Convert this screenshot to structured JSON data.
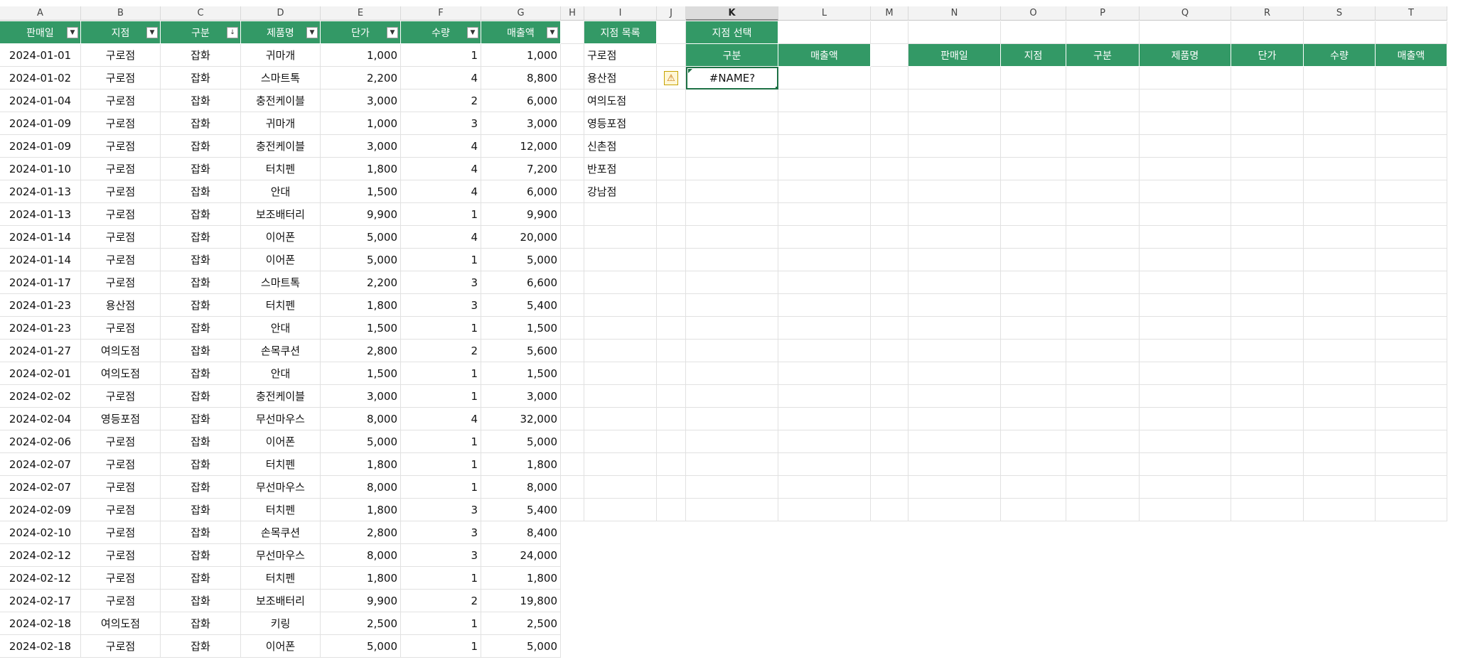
{
  "columns": [
    "A",
    "B",
    "C",
    "D",
    "E",
    "F",
    "G",
    "H",
    "I",
    "J",
    "K",
    "L",
    "M",
    "N",
    "O",
    "P",
    "Q",
    "R",
    "S",
    "T"
  ],
  "active_column": "K",
  "main_table": {
    "headers": [
      "판매일",
      "지점",
      "구분",
      "제품명",
      "단가",
      "수량",
      "매출액"
    ],
    "rows": [
      [
        "2024-01-01",
        "구로점",
        "잡화",
        "귀마개",
        "1,000",
        "1",
        "1,000"
      ],
      [
        "2024-01-02",
        "구로점",
        "잡화",
        "스마트톡",
        "2,200",
        "4",
        "8,800"
      ],
      [
        "2024-01-04",
        "구로점",
        "잡화",
        "충전케이블",
        "3,000",
        "2",
        "6,000"
      ],
      [
        "2024-01-09",
        "구로점",
        "잡화",
        "귀마개",
        "1,000",
        "3",
        "3,000"
      ],
      [
        "2024-01-09",
        "구로점",
        "잡화",
        "충전케이블",
        "3,000",
        "4",
        "12,000"
      ],
      [
        "2024-01-10",
        "구로점",
        "잡화",
        "터치펜",
        "1,800",
        "4",
        "7,200"
      ],
      [
        "2024-01-13",
        "구로점",
        "잡화",
        "안대",
        "1,500",
        "4",
        "6,000"
      ],
      [
        "2024-01-13",
        "구로점",
        "잡화",
        "보조배터리",
        "9,900",
        "1",
        "9,900"
      ],
      [
        "2024-01-14",
        "구로점",
        "잡화",
        "이어폰",
        "5,000",
        "4",
        "20,000"
      ],
      [
        "2024-01-14",
        "구로점",
        "잡화",
        "이어폰",
        "5,000",
        "1",
        "5,000"
      ],
      [
        "2024-01-17",
        "구로점",
        "잡화",
        "스마트톡",
        "2,200",
        "3",
        "6,600"
      ],
      [
        "2024-01-23",
        "용산점",
        "잡화",
        "터치펜",
        "1,800",
        "3",
        "5,400"
      ],
      [
        "2024-01-23",
        "구로점",
        "잡화",
        "안대",
        "1,500",
        "1",
        "1,500"
      ],
      [
        "2024-01-27",
        "여의도점",
        "잡화",
        "손목쿠션",
        "2,800",
        "2",
        "5,600"
      ],
      [
        "2024-02-01",
        "여의도점",
        "잡화",
        "안대",
        "1,500",
        "1",
        "1,500"
      ],
      [
        "2024-02-02",
        "구로점",
        "잡화",
        "충전케이블",
        "3,000",
        "1",
        "3,000"
      ],
      [
        "2024-02-04",
        "영등포점",
        "잡화",
        "무선마우스",
        "8,000",
        "4",
        "32,000"
      ],
      [
        "2024-02-06",
        "구로점",
        "잡화",
        "이어폰",
        "5,000",
        "1",
        "5,000"
      ],
      [
        "2024-02-07",
        "구로점",
        "잡화",
        "터치펜",
        "1,800",
        "1",
        "1,800"
      ],
      [
        "2024-02-07",
        "구로점",
        "잡화",
        "무선마우스",
        "8,000",
        "1",
        "8,000"
      ],
      [
        "2024-02-09",
        "구로점",
        "잡화",
        "터치펜",
        "1,800",
        "3",
        "5,400"
      ],
      [
        "2024-02-10",
        "구로점",
        "잡화",
        "손목쿠션",
        "2,800",
        "3",
        "8,400"
      ],
      [
        "2024-02-12",
        "구로점",
        "잡화",
        "무선마우스",
        "8,000",
        "3",
        "24,000"
      ],
      [
        "2024-02-12",
        "구로점",
        "잡화",
        "터치펜",
        "1,800",
        "1",
        "1,800"
      ],
      [
        "2024-02-17",
        "구로점",
        "잡화",
        "보조배터리",
        "9,900",
        "2",
        "19,800"
      ],
      [
        "2024-02-18",
        "여의도점",
        "잡화",
        "키링",
        "2,500",
        "1",
        "2,500"
      ],
      [
        "2024-02-18",
        "구로점",
        "잡화",
        "이어폰",
        "5,000",
        "1",
        "5,000"
      ]
    ]
  },
  "branch_list": {
    "header": "지점 목록",
    "items": [
      "구로점",
      "용산점",
      "여의도점",
      "영등포점",
      "신촌점",
      "반포점",
      "강남점"
    ]
  },
  "branch_select": {
    "header": "지점 선택"
  },
  "summary": {
    "headers": [
      "구분",
      "매출액"
    ],
    "result": "#NAME?"
  },
  "result_table": {
    "headers": [
      "판매일",
      "지점",
      "구분",
      "제품명",
      "단가",
      "수량",
      "매출액"
    ]
  },
  "icons": {
    "filter": "filter-dropdown-icon",
    "sorted_filter": "sort-filter-icon",
    "warning": "warning-icon"
  },
  "colors": {
    "header_green": "#339966",
    "active_border": "#1e7145"
  }
}
